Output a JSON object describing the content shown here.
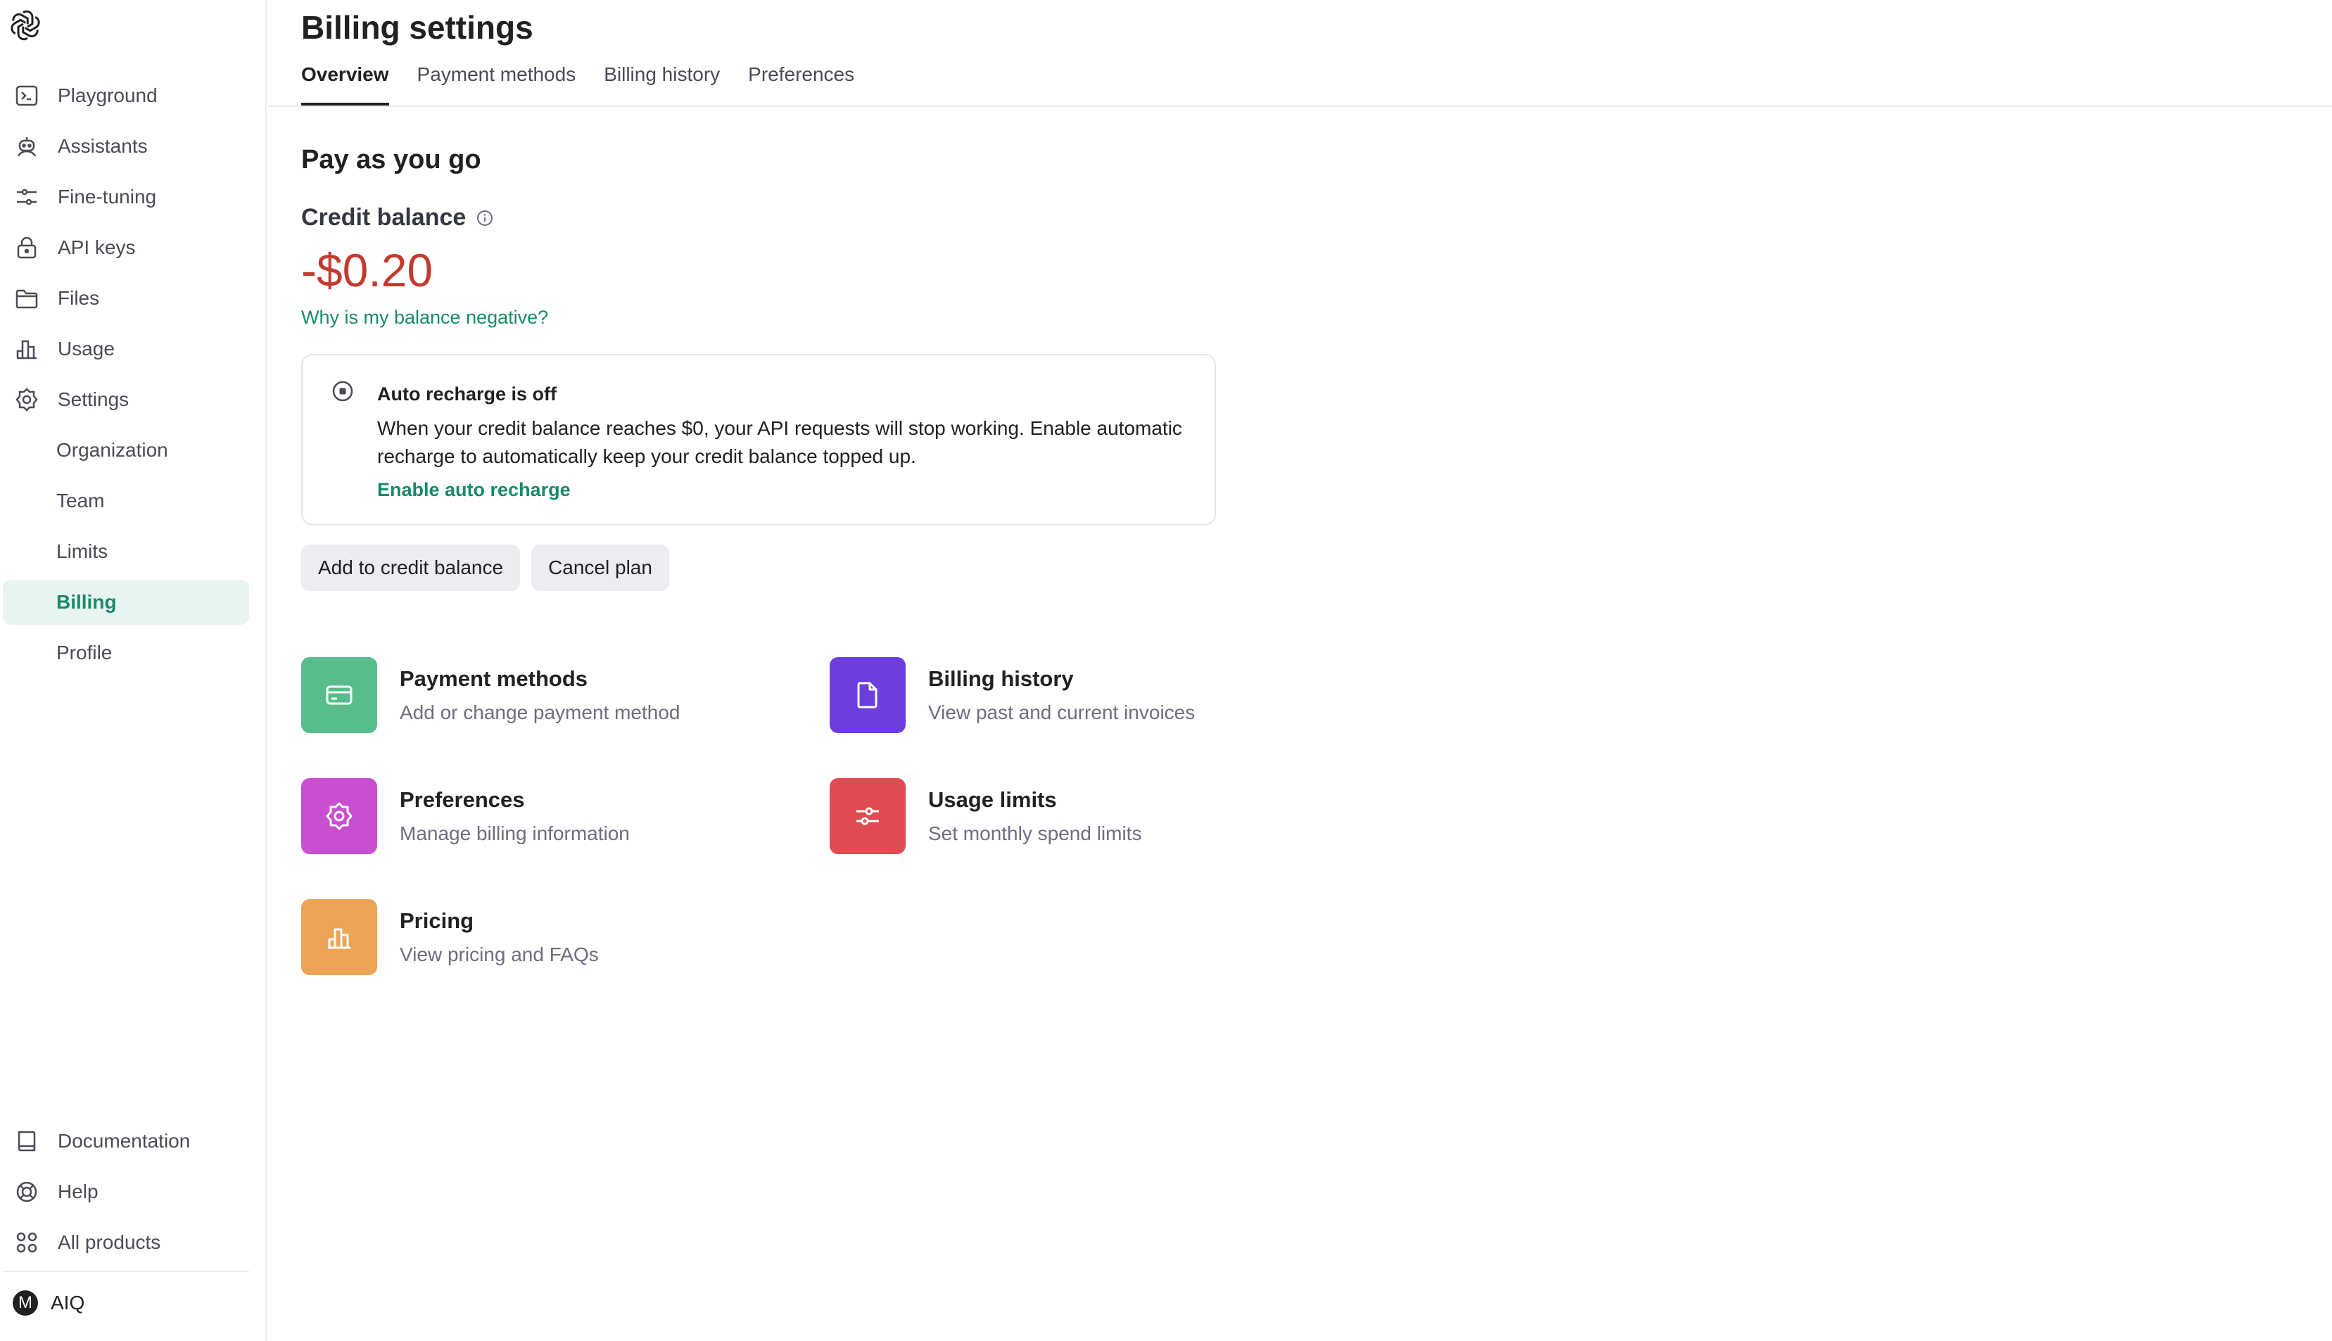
{
  "sidebar": {
    "nav": [
      {
        "label": "Playground",
        "icon": "terminal-icon"
      },
      {
        "label": "Assistants",
        "icon": "robot-icon"
      },
      {
        "label": "Fine-tuning",
        "icon": "sliders-icon"
      },
      {
        "label": "API keys",
        "icon": "lock-icon"
      },
      {
        "label": "Files",
        "icon": "folder-icon"
      },
      {
        "label": "Usage",
        "icon": "bar-chart-icon"
      },
      {
        "label": "Settings",
        "icon": "gear-icon"
      },
      {
        "label": "Organization"
      },
      {
        "label": "Team"
      },
      {
        "label": "Limits"
      },
      {
        "label": "Billing",
        "active": true
      },
      {
        "label": "Profile"
      }
    ],
    "bottom": [
      {
        "label": "Documentation",
        "icon": "book-icon"
      },
      {
        "label": "Help",
        "icon": "lifebuoy-icon"
      },
      {
        "label": "All products",
        "icon": "grid-icon"
      }
    ],
    "user": {
      "initial": "M",
      "name": "AIQ"
    }
  },
  "header": {
    "title": "Billing settings",
    "tabs": [
      {
        "label": "Overview",
        "active": true
      },
      {
        "label": "Payment methods"
      },
      {
        "label": "Billing history"
      },
      {
        "label": "Preferences"
      }
    ]
  },
  "overview": {
    "plan_title": "Pay as you go",
    "credit_label": "Credit balance",
    "balance": "-$0.20",
    "negative_link": "Why is my balance negative?",
    "recharge": {
      "title": "Auto recharge is off",
      "description": "When your credit balance reaches $0, your API requests will stop working. Enable automatic recharge to automatically keep your credit balance topped up.",
      "link": "Enable auto recharge"
    },
    "buttons": {
      "add_credit": "Add to credit balance",
      "cancel_plan": "Cancel plan"
    },
    "cards": [
      {
        "title": "Payment methods",
        "desc": "Add or change payment method",
        "icon": "credit-card-icon",
        "color": "#58bd8a"
      },
      {
        "title": "Billing history",
        "desc": "View past and current invoices",
        "icon": "document-icon",
        "color": "#6c3ee0"
      },
      {
        "title": "Preferences",
        "desc": "Manage billing information",
        "icon": "gear-icon",
        "color": "#c94fd1"
      },
      {
        "title": "Usage limits",
        "desc": "Set monthly spend limits",
        "icon": "sliders-icon",
        "color": "#df4b51"
      },
      {
        "title": "Pricing",
        "desc": "View pricing and FAQs",
        "icon": "bar-chart-icon",
        "color": "#eda457"
      }
    ]
  },
  "colors": {
    "accent": "#188a68",
    "negative": "#c23b30",
    "active_nav_bg": "#e8f4f1"
  }
}
